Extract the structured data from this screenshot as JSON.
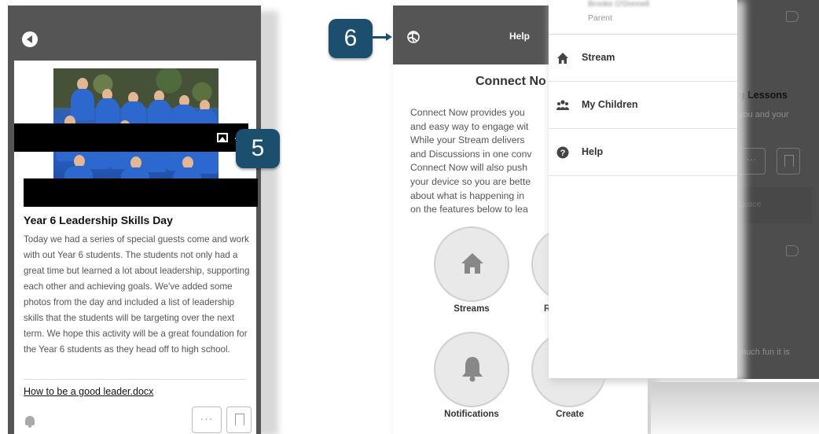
{
  "callouts": {
    "five": "5",
    "six": "6"
  },
  "post": {
    "image_count": "4",
    "title": "Year 6 Leadership Skills Day",
    "body": "Today we had a series of special guests come and work with out Year 6 students.  The students not only had a great time but learned a lot about leadership, supporting each other and achieving goals.  We've added some photos from the day and included a list of leadership skills that the students will be targeting over the next term.  We hope this activity will be a great foundation for the Year 6 students as they head off to high school.",
    "attachment": "How to be a good leader.docx",
    "more_label": "···"
  },
  "help_screen": {
    "header_title": "Help",
    "heading": "Connect No",
    "text_lines": [
      "Connect Now provides you",
      "and easy way to engage wit",
      "While your Stream delivers",
      "and Discussions in one conv",
      "Connect Now will also push",
      "your device so you are bette",
      "about what is happening in",
      "on the features below to lea"
    ],
    "features": [
      {
        "label": "Streams",
        "icon": "home-icon"
      },
      {
        "label": "R",
        "icon": "unknown"
      },
      {
        "label": "Notifications",
        "icon": "bell-icon"
      },
      {
        "label": "Create",
        "icon": "unknown"
      }
    ]
  },
  "drawer": {
    "user_name": "Brooke O'Donnell",
    "user_role": "Parent",
    "items": [
      {
        "label": "Stream",
        "icon": "home-icon"
      },
      {
        "label": "My Children",
        "icon": "users-icon"
      },
      {
        "label": "Help",
        "icon": "question-icon"
      }
    ]
  },
  "background_panel": {
    "title_fragment": "g Lessons",
    "sub_fragment": "you and your",
    "more_label": "···",
    "notice": "Notice",
    "footer_fragment": "much fun it is"
  },
  "colors": {
    "header_gray": "#555555",
    "callout_blue": "#1c4f6e",
    "shirt_blue": "#2d68cf"
  }
}
